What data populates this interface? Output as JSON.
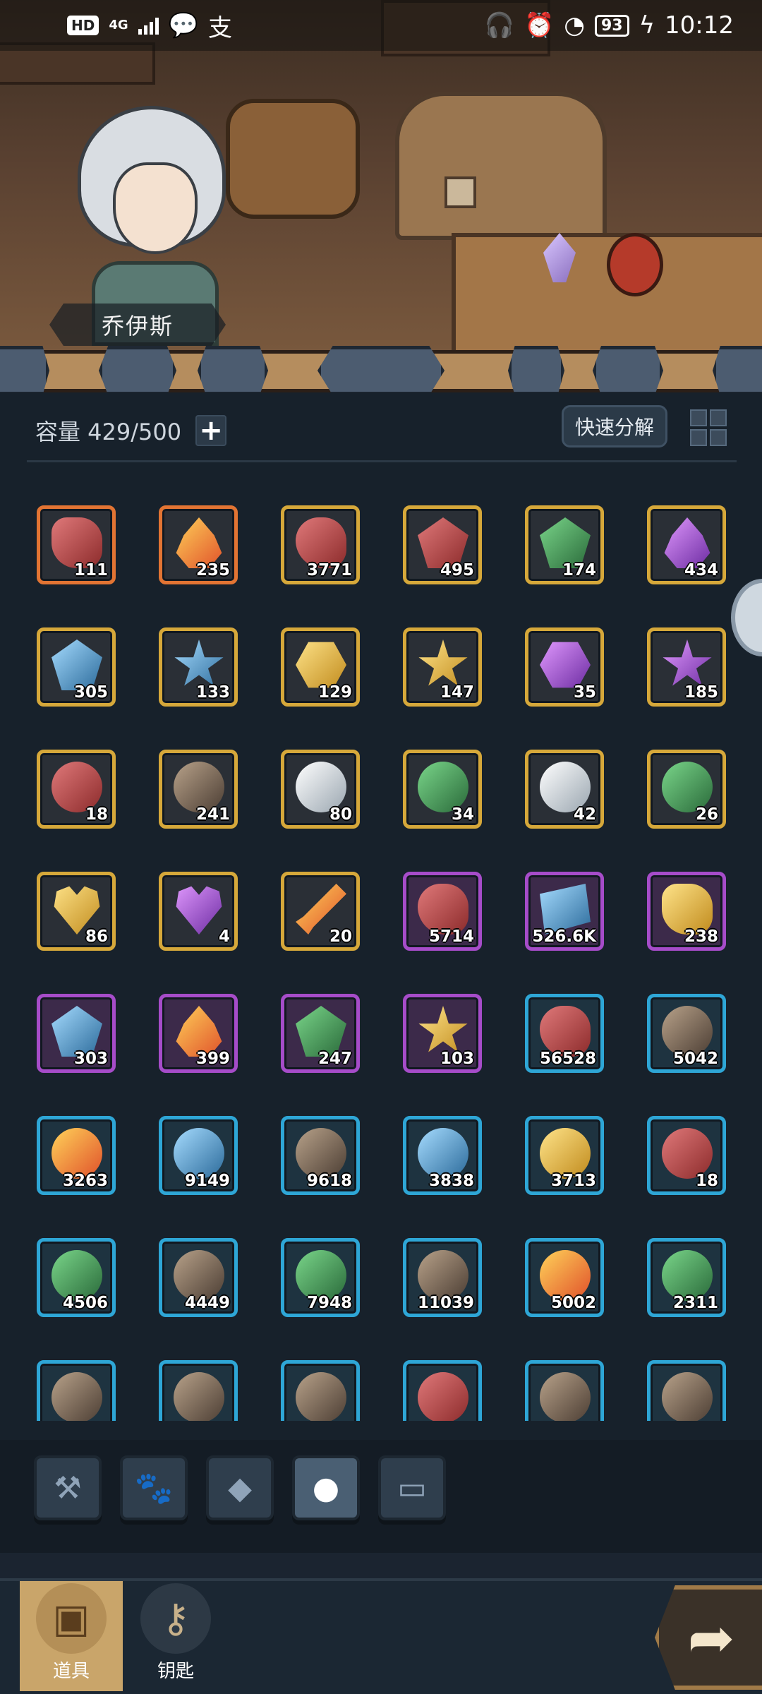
{
  "status_bar": {
    "hd": "HD",
    "network": "4G",
    "time": "10:12",
    "battery": "93",
    "alipay": "支"
  },
  "hero": {
    "name": "乔伊斯"
  },
  "inventory": {
    "capacity_label": "容量 429/500",
    "add_label": "+",
    "quick_decompose_label": "快速分解",
    "items": [
      {
        "count": "111",
        "rarity": "orange",
        "icon": "red-ore-icon"
      },
      {
        "count": "235",
        "rarity": "orange",
        "icon": "fire-essence-icon"
      },
      {
        "count": "3771",
        "rarity": "gold",
        "icon": "meat-slab-icon"
      },
      {
        "count": "495",
        "rarity": "gold",
        "icon": "red-crystal-icon"
      },
      {
        "count": "174",
        "rarity": "gold",
        "icon": "green-shard-icon"
      },
      {
        "count": "434",
        "rarity": "gold",
        "icon": "purple-flame-icon"
      },
      {
        "count": "305",
        "rarity": "gold",
        "icon": "blue-crystal-icon"
      },
      {
        "count": "133",
        "rarity": "gold",
        "icon": "blue-star-icon"
      },
      {
        "count": "129",
        "rarity": "gold",
        "icon": "amber-gem-icon"
      },
      {
        "count": "147",
        "rarity": "gold",
        "icon": "gold-star-gem-icon"
      },
      {
        "count": "35",
        "rarity": "gold",
        "icon": "purple-gem-icon"
      },
      {
        "count": "185",
        "rarity": "gold",
        "icon": "purple-star-gem-icon"
      },
      {
        "count": "18",
        "rarity": "gold",
        "icon": "red-dragon-portrait-icon"
      },
      {
        "count": "241",
        "rarity": "gold",
        "icon": "girl-hero-portrait-icon"
      },
      {
        "count": "80",
        "rarity": "gold",
        "icon": "white-knight-portrait-icon"
      },
      {
        "count": "34",
        "rarity": "gold",
        "icon": "green-hero-portrait-icon"
      },
      {
        "count": "42",
        "rarity": "gold",
        "icon": "white-beast-portrait-icon"
      },
      {
        "count": "26",
        "rarity": "gold",
        "icon": "green-beast-portrait-icon"
      },
      {
        "count": "86",
        "rarity": "gold",
        "icon": "gold-heart-icon"
      },
      {
        "count": "4",
        "rarity": "gold",
        "icon": "purple-heart-icon"
      },
      {
        "count": "20",
        "rarity": "gold",
        "icon": "fire-sword-icon"
      },
      {
        "count": "5714",
        "rarity": "purple",
        "icon": "meat-leg-icon"
      },
      {
        "count": "526.6K",
        "rarity": "purple",
        "icon": "blue-scroll-icon"
      },
      {
        "count": "238",
        "rarity": "purple",
        "icon": "gold-ore-icon"
      },
      {
        "count": "303",
        "rarity": "purple",
        "icon": "blue-leaf-icon"
      },
      {
        "count": "399",
        "rarity": "purple",
        "icon": "fire-essence-icon"
      },
      {
        "count": "247",
        "rarity": "purple",
        "icon": "green-leaf-icon"
      },
      {
        "count": "103",
        "rarity": "purple",
        "icon": "gold-star-icon"
      },
      {
        "count": "56528",
        "rarity": "blue",
        "icon": "chicken-leg-icon"
      },
      {
        "count": "5042",
        "rarity": "blue",
        "icon": "orc-portrait-icon"
      },
      {
        "count": "3263",
        "rarity": "blue",
        "icon": "fire-lion-portrait-icon"
      },
      {
        "count": "9149",
        "rarity": "blue",
        "icon": "ice-warrior-portrait-icon"
      },
      {
        "count": "9618",
        "rarity": "blue",
        "icon": "brown-beast-portrait-icon"
      },
      {
        "count": "3838",
        "rarity": "blue",
        "icon": "water-spirit-portrait-icon"
      },
      {
        "count": "3713",
        "rarity": "blue",
        "icon": "gold-king-portrait-icon"
      },
      {
        "count": "18",
        "rarity": "blue",
        "icon": "red-dragon-portrait-icon"
      },
      {
        "count": "4506",
        "rarity": "blue",
        "icon": "tree-ent-portrait-icon"
      },
      {
        "count": "4449",
        "rarity": "blue",
        "icon": "dark-wolf-portrait-icon"
      },
      {
        "count": "7948",
        "rarity": "blue",
        "icon": "snake-portrait-icon"
      },
      {
        "count": "11039",
        "rarity": "blue",
        "icon": "rock-golem-portrait-icon"
      },
      {
        "count": "5002",
        "rarity": "blue",
        "icon": "fire-bird-portrait-icon"
      },
      {
        "count": "2311",
        "rarity": "blue",
        "icon": "green-goblin-portrait-icon"
      },
      {
        "count": "",
        "rarity": "blue",
        "icon": "girl-hero-portrait-icon"
      },
      {
        "count": "",
        "rarity": "blue",
        "icon": "dark-cat-portrait-icon"
      },
      {
        "count": "",
        "rarity": "blue",
        "icon": "mushroom-portrait-icon"
      },
      {
        "count": "",
        "rarity": "blue",
        "icon": "red-green-demon-portrait-icon"
      },
      {
        "count": "",
        "rarity": "blue",
        "icon": "dark-elf-portrait-icon"
      },
      {
        "count": "",
        "rarity": "blue",
        "icon": "orc-warrior-portrait-icon"
      }
    ]
  },
  "category_tabs": [
    {
      "icon": "hammer-icon",
      "active": false
    },
    {
      "icon": "paw-icon",
      "active": false
    },
    {
      "icon": "diamond-icon",
      "active": false
    },
    {
      "icon": "ore-icon",
      "active": true
    },
    {
      "icon": "chest-icon",
      "active": false
    }
  ],
  "bottom_nav": [
    {
      "label": "道具",
      "icon": "chest-icon",
      "active": true
    },
    {
      "label": "钥匙",
      "icon": "key-icon",
      "active": false
    }
  ],
  "colors": {
    "orange": "#e27433",
    "gold": "#d6a83a",
    "purple": "#a64cc9",
    "blue": "#2ea6d6",
    "panel": "#17212b",
    "accent": "#c9a56a"
  }
}
